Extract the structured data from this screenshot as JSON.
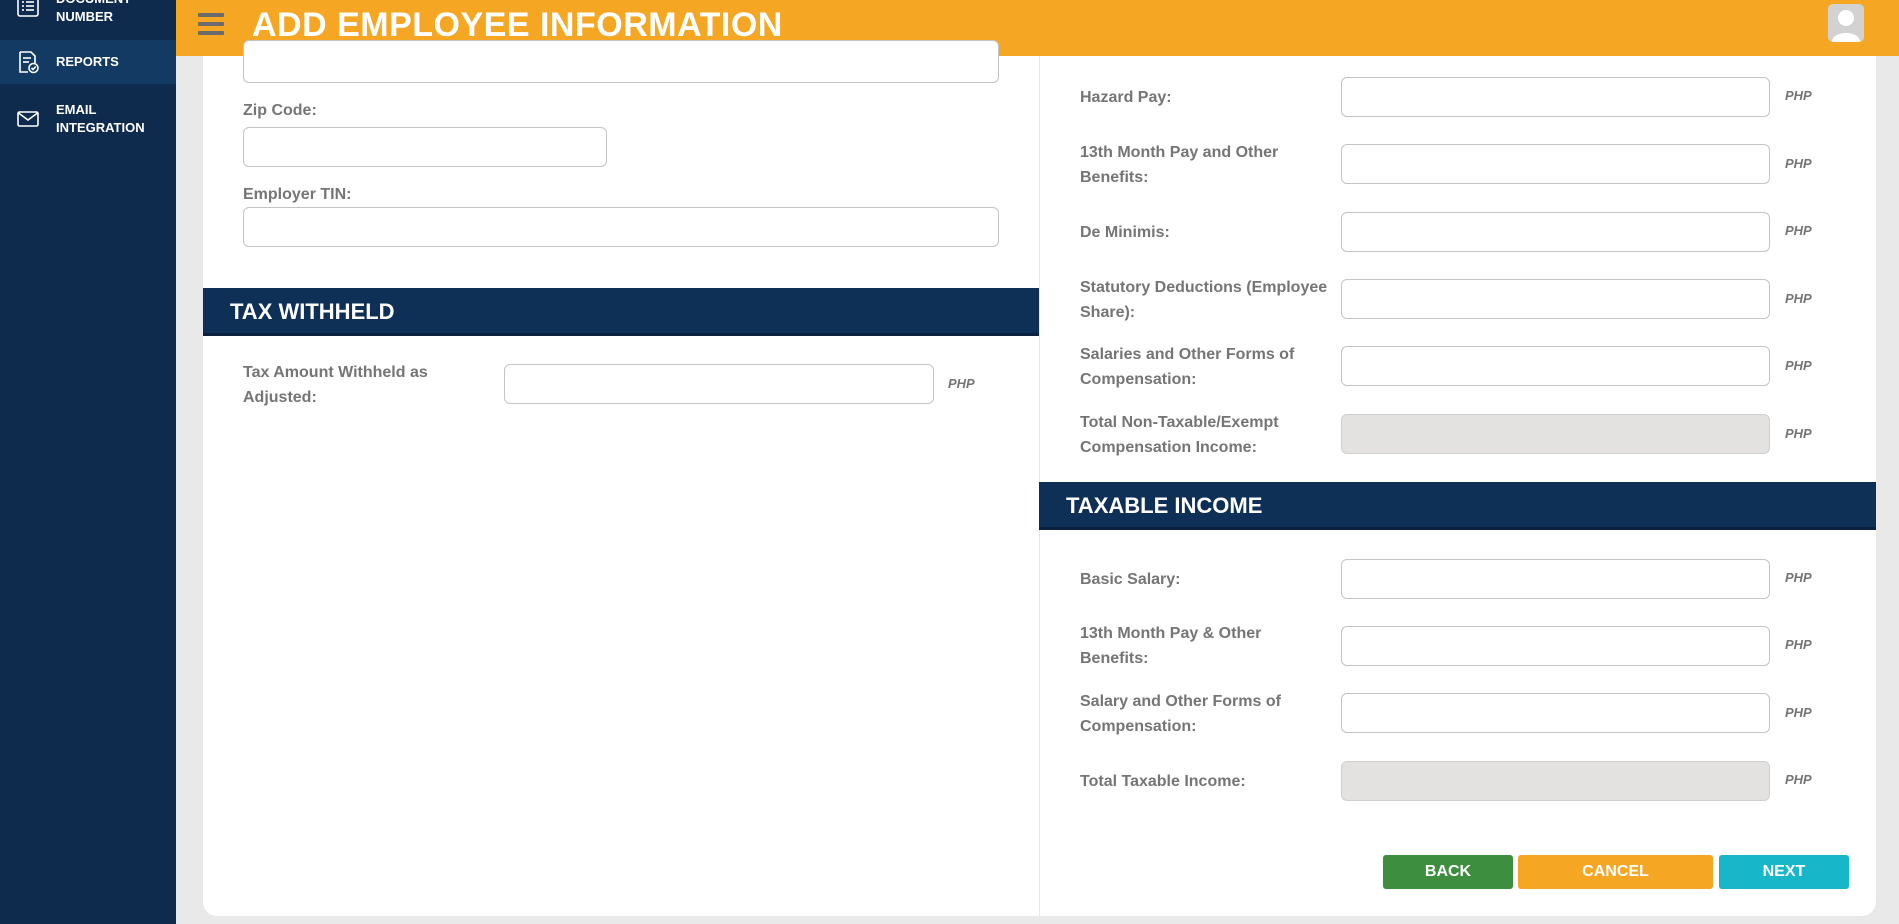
{
  "sidebar": {
    "items": [
      {
        "label": "DOCUMENT NUMBER",
        "icon": "list-icon"
      },
      {
        "label": "REPORTS",
        "icon": "report-check-icon"
      },
      {
        "label": "EMAIL INTEGRATION",
        "icon": "envelope-icon"
      }
    ]
  },
  "header": {
    "title": "ADD EMPLOYEE INFORMATION",
    "menu_icon": "hamburger-icon",
    "avatar_icon": "user-avatar-icon"
  },
  "left": {
    "zip_label": "Zip Code:",
    "zip_value": "",
    "tin_label": "Employer TIN:",
    "tin_value": "",
    "tax_section_title": "TAX WITHHELD",
    "tax_amount_label": "Tax Amount Withheld as Adjusted:",
    "tax_amount_value": "",
    "tax_amount_unit": "PHP"
  },
  "right": {
    "nontaxable_fields": [
      {
        "label": "Hazard Pay:",
        "value": "",
        "unit": "PHP"
      },
      {
        "label": "13th Month Pay and Other Benefits:",
        "value": "",
        "unit": "PHP"
      },
      {
        "label": "De Minimis:",
        "value": "",
        "unit": "PHP"
      },
      {
        "label": "Statutory Deductions (Employee Share):",
        "value": "",
        "unit": "PHP"
      },
      {
        "label": "Salaries and Other Forms of Compensation:",
        "value": "",
        "unit": "PHP"
      },
      {
        "label": "Total Non-Taxable/Exempt Compensation Income:",
        "value": "",
        "unit": "PHP"
      }
    ],
    "taxable_section_title": "TAXABLE INCOME",
    "taxable_fields": [
      {
        "label": "Basic Salary:",
        "value": "",
        "unit": "PHP"
      },
      {
        "label": "13th Month Pay & Other Benefits:",
        "value": "",
        "unit": "PHP"
      },
      {
        "label": "Salary and Other Forms of Compensation:",
        "value": "",
        "unit": "PHP"
      },
      {
        "label": "Total Taxable Income:",
        "value": "",
        "unit": "PHP"
      }
    ]
  },
  "buttons": {
    "back": "BACK",
    "cancel": "CANCEL",
    "next": "NEXT"
  },
  "colors": {
    "header": "#f5a623",
    "sidebar": "#0e2b4d",
    "section_bar": "#0e3057",
    "back_button": "#3d8e3e",
    "cancel_button": "#f5a623",
    "next_button": "#17b6c9"
  }
}
